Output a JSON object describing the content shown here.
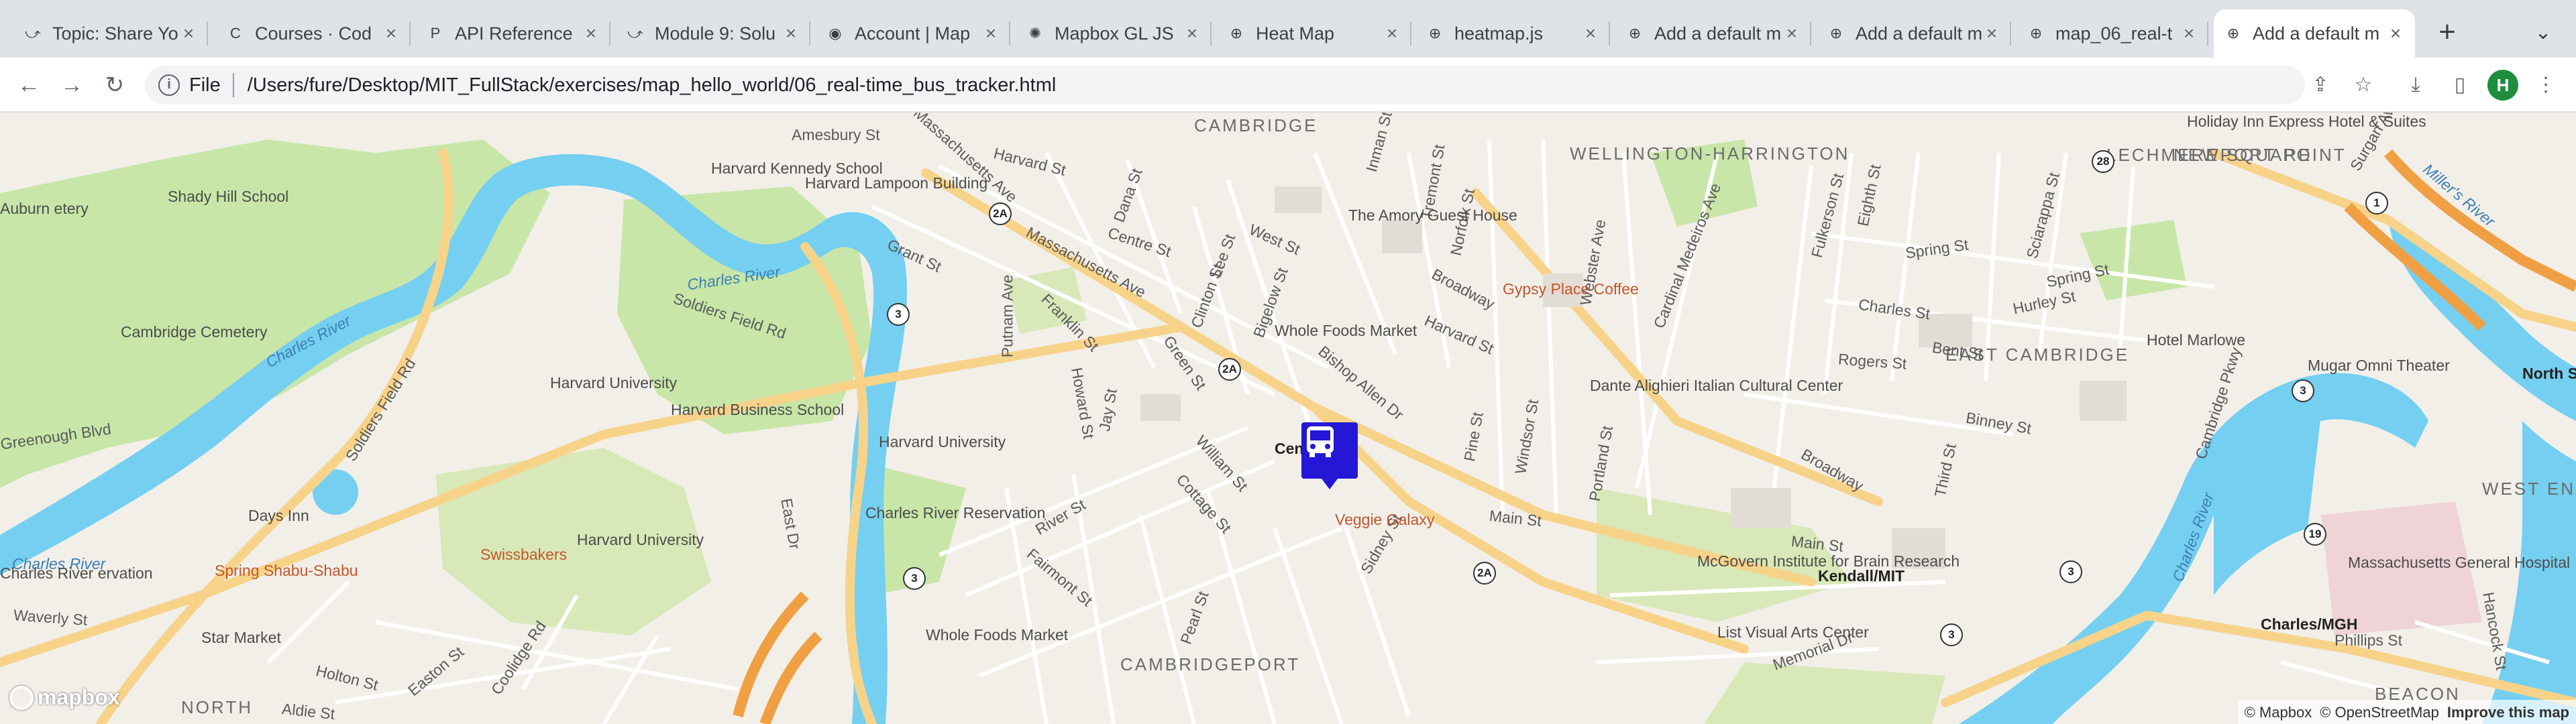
{
  "tabs": [
    {
      "title": "Topic: Share Yo",
      "icon": "spinner"
    },
    {
      "title": "Courses · Cod",
      "icon": "coursera-icon"
    },
    {
      "title": "API Reference",
      "icon": "p-icon"
    },
    {
      "title": "Module 9: Solu",
      "icon": "spinner"
    },
    {
      "title": "Account | Map",
      "icon": "mapbox-icon"
    },
    {
      "title": "Mapbox GL JS",
      "icon": "openai-icon"
    },
    {
      "title": "Heat Map",
      "icon": "globe-icon"
    },
    {
      "title": "heatmap.js",
      "icon": "globe-icon"
    },
    {
      "title": "Add a default m",
      "icon": "globe-icon"
    },
    {
      "title": "Add a default m",
      "icon": "globe-icon"
    },
    {
      "title": "map_06_real-t",
      "icon": "globe-icon"
    },
    {
      "title": "Add a default m",
      "icon": "globe-icon"
    }
  ],
  "address": {
    "scheme": "File",
    "url": "/Users/fure/Desktop/MIT_FullStack/exercises/map_hello_world/06_real-time_bus_tracker.html"
  },
  "profile_initial": "H",
  "map": {
    "districts": [
      "CAMBRIDGE",
      "WELLINGTON-HARRINGTON",
      "LECHMERE SQUARE",
      "NEWPORT POINT",
      "EAST CAMBRIDGE",
      "WEST EN",
      "CAMBRIDGEPORT",
      "NORTH",
      "BEACON"
    ],
    "water_labels": [
      "Charles River",
      "Charles River",
      "Charles River",
      "Charles River",
      "Miller's River"
    ],
    "streets": [
      "Massachusetts Ave",
      "Harvard St",
      "Dana St",
      "Centre St",
      "Lee St",
      "Clinton St",
      "Bigelow St",
      "West St",
      "Inman St",
      "Tremont St",
      "Norfolk St",
      "Broadway",
      "Harvard St",
      "Webster Ave",
      "Cardinal Medeiros Ave",
      "Fulkerson St",
      "Eighth St",
      "Spring St",
      "Charles St",
      "Bent St",
      "Rogers St",
      "Sciarappa St",
      "Hurley St",
      "Spring St",
      "Binney St",
      "Third St",
      "Cambridge Pkwy",
      "Greenough Blvd",
      "Soldiers Field Rd",
      "Soldiers Field Rd",
      "Putnam Ave",
      "Franklin St",
      "Green St",
      "Grant St",
      "Massachusetts Ave",
      "Bishop Allen Dr",
      "Pine St",
      "Windsor St",
      "Portland St",
      "Main St",
      "Main St",
      "Broadway",
      "Howard St",
      "Jay St",
      "River St",
      "William St",
      "Cottage St",
      "Sidney St",
      "East Dr",
      "Waverly St",
      "Holton St",
      "Easton St",
      "Coolidge Rd",
      "Aldie St",
      "Fairmont St",
      "Pearl St",
      "Memorial Dr",
      "Phillips St",
      "Hancock St",
      "Surgan Ave",
      "Amesbury St"
    ],
    "pois": [
      "Shady Hill School",
      "Harvard Kennedy School",
      "Harvard Lampoon Building",
      "The Amory Guest House",
      "Gypsy Place Coffee",
      "Whole Foods Market",
      "Cambridge Cemetery",
      "Harvard University",
      "Harvard Business School",
      "Harvard University",
      "Dante Alighieri Italian Cultural Center",
      "Hotel Marlowe",
      "Mugar Omni Theater",
      "Veggie Galaxy",
      "Days Inn",
      "Spring Shabu-Shabu",
      "Swissbakers",
      "Harvard University",
      "Charles River Reservation",
      "Star Market",
      "Whole Foods Market",
      "McGovern Institute for Brain Research",
      "List Visual Arts Center",
      "Massachusetts General Hospital",
      "Holiday Inn Express Hotel & Suites",
      "Auburn etery",
      "Charles River ervation"
    ],
    "stations": [
      "Cen",
      "Kendall/MIT",
      "Charles/MGH",
      "North St"
    ],
    "route_shields": [
      "2A",
      "3",
      "2A",
      "3",
      "2A",
      "28",
      "1",
      "3",
      "3",
      "3",
      "19"
    ],
    "logo": "mapbox",
    "attribution": [
      "© Mapbox",
      "© OpenStreetMap",
      "Improve this map"
    ]
  },
  "colors": {
    "bus_marker": "#2418d6",
    "water": "#75cff0",
    "park": "#c8e6a8",
    "major_road": "#f7d38a"
  }
}
